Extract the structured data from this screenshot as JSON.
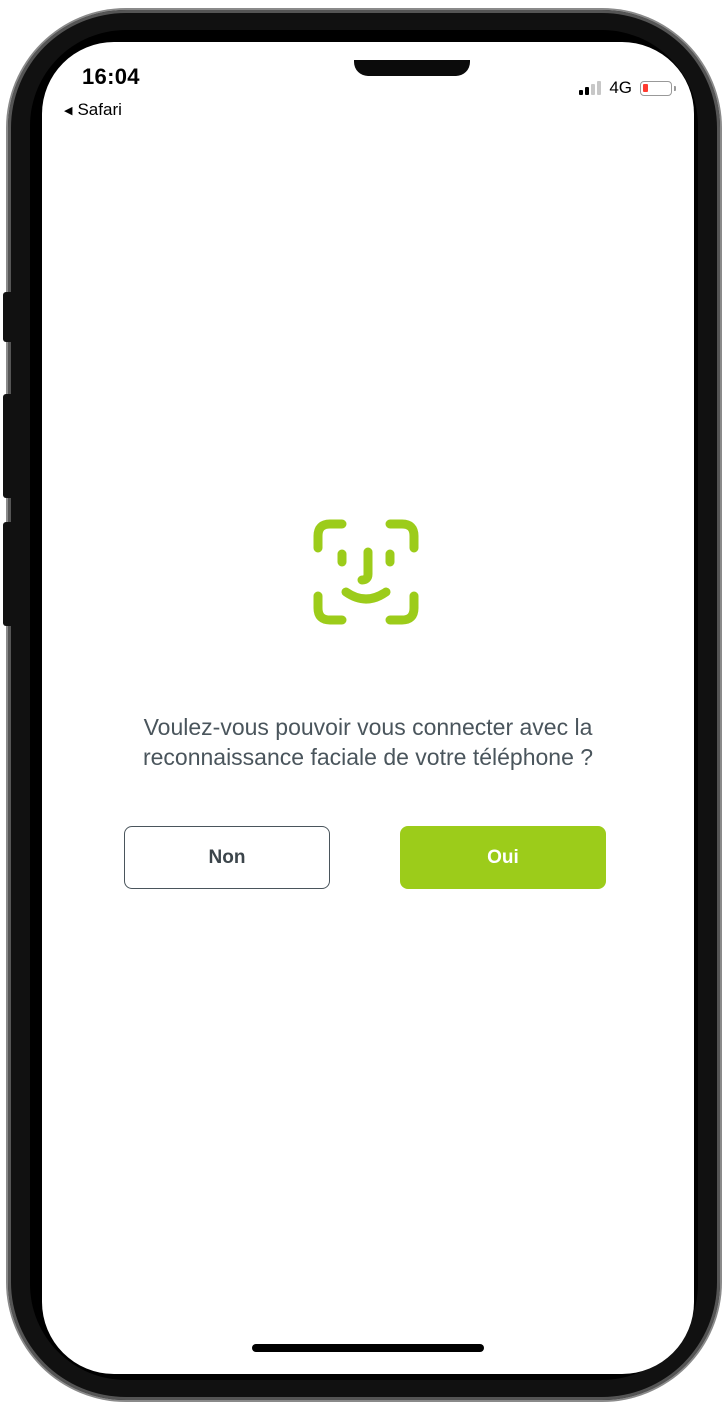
{
  "status_bar": {
    "time": "16:04",
    "back_app": "Safari",
    "network": "4G",
    "battery_level": 0.1,
    "battery_color": "#ff3b30",
    "signal_bars_active": 2
  },
  "dialog": {
    "icon": "face-id-icon",
    "accent_color": "#9ccc1a",
    "prompt_line1": "Voulez-vous pouvoir vous connecter avec la",
    "prompt_line2": "reconnaissance faciale de votre téléphone ?",
    "no_label": "Non",
    "yes_label": "Oui"
  }
}
